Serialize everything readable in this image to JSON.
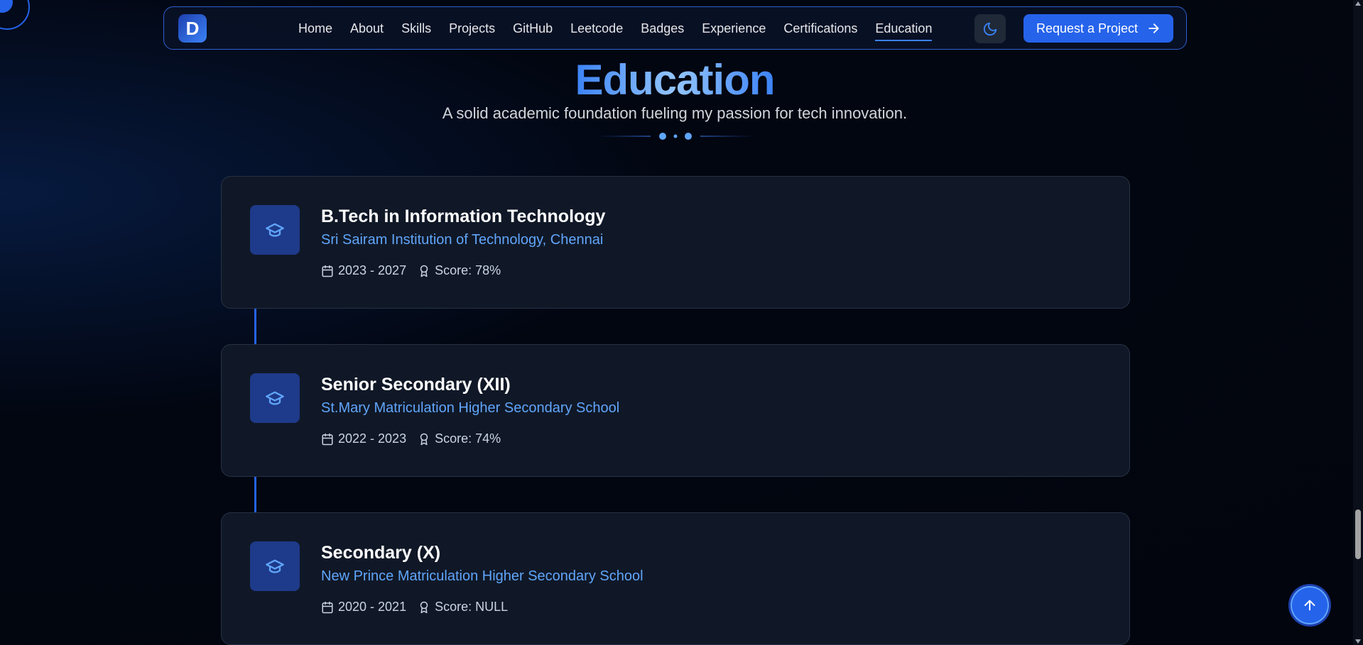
{
  "nav": {
    "logo_letter": "D",
    "links": [
      "Home",
      "About",
      "Skills",
      "Projects",
      "GitHub",
      "Leetcode",
      "Badges",
      "Experience",
      "Certifications",
      "Education"
    ],
    "active": "Education",
    "theme_icon": "moon-icon",
    "cta_label": "Request a Project",
    "cta_icon": "arrow-right-icon"
  },
  "section": {
    "title": "Education",
    "subtitle": "A solid academic foundation fueling my passion for tech innovation."
  },
  "education": [
    {
      "degree": "B.Tech in Information Technology",
      "institution": "Sri Sairam Institution of Technology, Chennai",
      "years": "2023 - 2027",
      "score": "Score: 78%"
    },
    {
      "degree": "Senior Secondary (XII)",
      "institution": "St.Mary Matriculation Higher Secondary School",
      "years": "2022 - 2023",
      "score": "Score: 74%"
    },
    {
      "degree": "Secondary (X)",
      "institution": "New Prince Matriculation Higher Secondary School",
      "years": "2020 - 2021",
      "score": "Score: NULL"
    }
  ],
  "icons": {
    "card": "graduation-cap-icon",
    "date": "calendar-icon",
    "score": "award-icon",
    "scroll_top": "arrow-up-icon"
  },
  "colors": {
    "accent": "#2563eb",
    "accent_light": "#60a5fa",
    "card_bg": "#101827",
    "page_bg": "#02050d"
  }
}
